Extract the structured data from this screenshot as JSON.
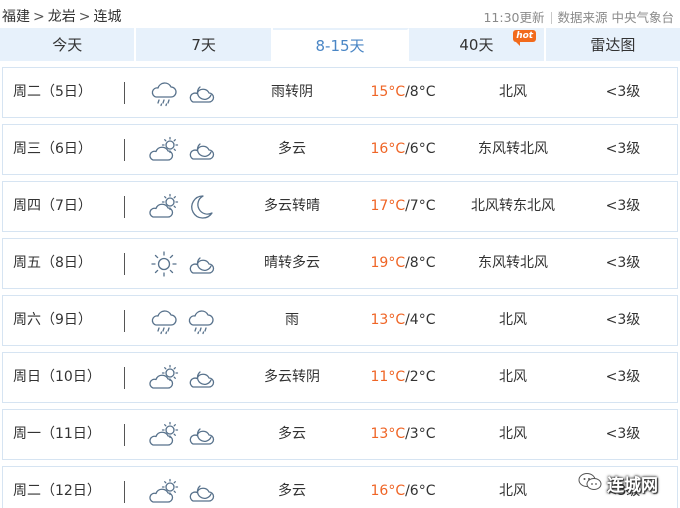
{
  "breadcrumb": {
    "province": "福建",
    "city": "龙岩",
    "district": "连城",
    "separator": ">"
  },
  "meta": {
    "updated": "11:30更新",
    "source": "数据来源 中央气象台"
  },
  "tabs": [
    {
      "label": "今天",
      "active": false
    },
    {
      "label": "7天",
      "active": false
    },
    {
      "label": "8-15天",
      "active": true
    },
    {
      "label": "40天",
      "active": false,
      "badge": "hot"
    },
    {
      "label": "雷达图",
      "active": false
    }
  ],
  "forecast": [
    {
      "day": "周二（5日）",
      "icon_day": "rain-cloud-icon",
      "icon_night": "cloudy-night-icon",
      "condition": "雨转阴",
      "high": "15°C",
      "low": "/8°C",
      "wind": "北风",
      "level": "<3级"
    },
    {
      "day": "周三（6日）",
      "icon_day": "partly-cloudy-icon",
      "icon_night": "cloudy-night-icon",
      "condition": "多云",
      "high": "16°C",
      "low": "/6°C",
      "wind": "东风转北风",
      "level": "<3级"
    },
    {
      "day": "周四（7日）",
      "icon_day": "partly-cloudy-icon",
      "icon_night": "moon-icon",
      "condition": "多云转晴",
      "high": "17°C",
      "low": "/7°C",
      "wind": "北风转东北风",
      "level": "<3级"
    },
    {
      "day": "周五（8日）",
      "icon_day": "sun-icon",
      "icon_night": "cloudy-night-icon",
      "condition": "晴转多云",
      "high": "19°C",
      "low": "/8°C",
      "wind": "东风转北风",
      "level": "<3级"
    },
    {
      "day": "周六（9日）",
      "icon_day": "rain-cloud-icon",
      "icon_night": "rain-cloud-icon",
      "condition": "雨",
      "high": "13°C",
      "low": "/4°C",
      "wind": "北风",
      "level": "<3级"
    },
    {
      "day": "周日（10日）",
      "icon_day": "partly-cloudy-icon",
      "icon_night": "cloudy-night-icon",
      "condition": "多云转阴",
      "high": "11°C",
      "low": "/2°C",
      "wind": "北风",
      "level": "<3级"
    },
    {
      "day": "周一（11日）",
      "icon_day": "partly-cloudy-icon",
      "icon_night": "cloudy-night-icon",
      "condition": "多云",
      "high": "13°C",
      "low": "/3°C",
      "wind": "北风",
      "level": "<3级"
    },
    {
      "day": "周二（12日）",
      "icon_day": "partly-cloudy-icon",
      "icon_night": "cloudy-night-icon",
      "condition": "多云",
      "high": "16°C",
      "low": "/6°C",
      "wind": "北风",
      "level": "<3级"
    }
  ],
  "watermark": {
    "text": "连城网"
  },
  "colors": {
    "tab_bg": "#e7f1fb",
    "active_tab_text": "#4a86c5",
    "high_temp": "#ef6526",
    "row_border": "#d6e4f2",
    "hot_badge": "#f26a1b"
  }
}
